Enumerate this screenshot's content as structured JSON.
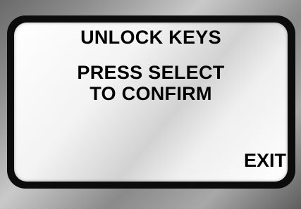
{
  "screen": {
    "title": "UNLOCK KEYS",
    "message_line1": "PRESS SELECT",
    "message_line2": "TO CONFIRM",
    "softkey_right": "EXIT"
  },
  "colors": {
    "bezel": "#0c0c0c",
    "text": "#000000"
  }
}
